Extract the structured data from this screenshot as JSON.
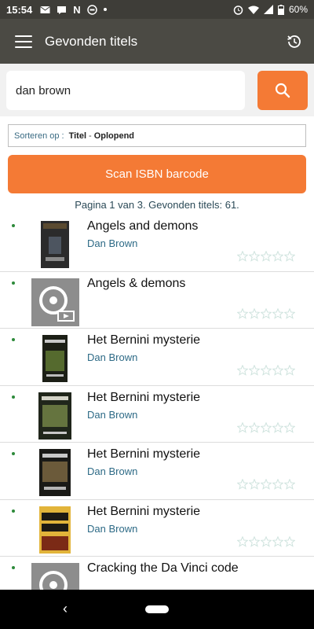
{
  "status_bar": {
    "time": "15:54",
    "notification_icons": [
      "mail-icon",
      "chat-icon",
      "netflix-icon",
      "dot-circle-icon",
      "dot-icon"
    ],
    "battery": "60%"
  },
  "app_bar": {
    "title": "Gevonden titels"
  },
  "search": {
    "query": "dan brown"
  },
  "sort": {
    "label": "Sorteren op :",
    "field": "Titel",
    "separator": "-",
    "order": "Oplopend"
  },
  "scan_button": {
    "label": "Scan ISBN barcode"
  },
  "page_info": "Pagina 1 van 3. Gevonden titels: 61.",
  "results": [
    {
      "title": "Angels and demons",
      "author": "Dan Brown",
      "cover": "book-cover",
      "rating": 0
    },
    {
      "title": "Angels & demons",
      "author": "",
      "cover": "video-disc-placeholder",
      "rating": 0
    },
    {
      "title": "Het Bernini mysterie",
      "author": "Dan Brown",
      "cover": "book-cover",
      "rating": 0
    },
    {
      "title": "Het Bernini mysterie",
      "author": "Dan Brown",
      "cover": "book-cover",
      "rating": 0
    },
    {
      "title": "Het Bernini mysterie",
      "author": "Dan Brown",
      "cover": "book-cover",
      "rating": 0
    },
    {
      "title": "Het Bernini mysterie",
      "author": "Dan Brown",
      "cover": "book-cover",
      "rating": 0
    },
    {
      "title": "Cracking the Da Vinci code",
      "author": "",
      "cover": "video-disc-placeholder",
      "rating": 0
    }
  ],
  "colors": {
    "accent": "#f47a35",
    "app_bar": "#4b4a44",
    "status_bar": "#3e3d38",
    "author_link": "#2d6a86",
    "available_dot": "#2d8a3a"
  }
}
